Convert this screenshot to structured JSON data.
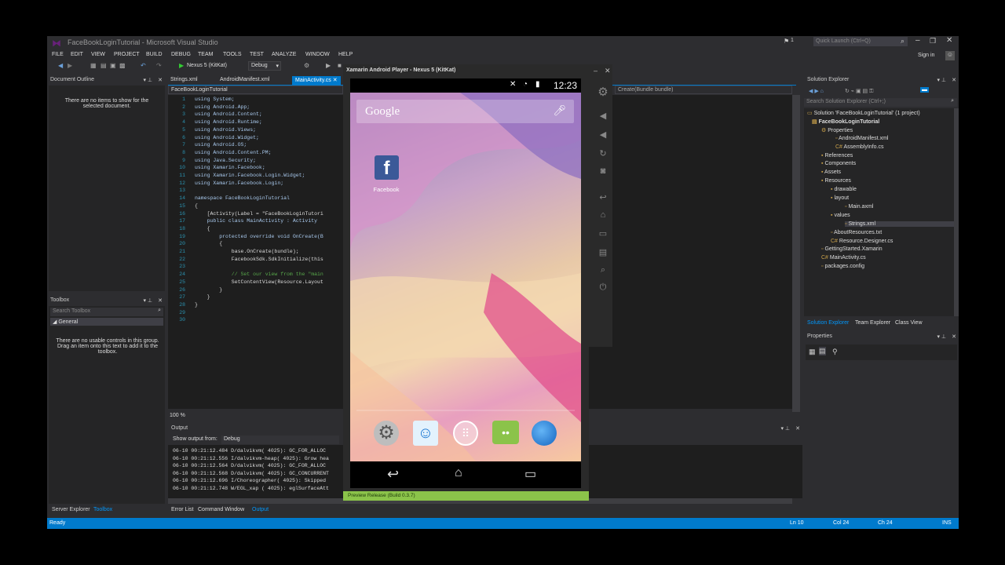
{
  "window": {
    "title": "FaceBookLoginTutorial - Microsoft Visual Studio",
    "quick_launch": "Quick Launch (Ctrl+Q)",
    "sign_in": "Sign in",
    "notif_count": "1"
  },
  "menu": [
    "FILE",
    "EDIT",
    "VIEW",
    "PROJECT",
    "BUILD",
    "DEBUG",
    "TEAM",
    "TOOLS",
    "TEST",
    "ANALYZE",
    "WINDOW",
    "HELP"
  ],
  "toolbar": {
    "device": "Nexus 5 (KitKat)",
    "config": "Debug"
  },
  "doc_outline": {
    "title": "Document Outline",
    "empty": "There are no items to show for the selected document."
  },
  "toolbox": {
    "title": "Toolbox",
    "search": "Search Toolbox",
    "group": "General",
    "empty": "There are no usable controls in this group. Drag an item onto this text to add it to the toolbox."
  },
  "bottom_tabs_left": [
    "Server Explorer",
    "Toolbox"
  ],
  "editor": {
    "tabs": [
      "Strings.xml",
      "AndroidManifest.xml",
      "MainActivity.cs"
    ],
    "nav": "FaceBookLoginTutorial",
    "nav_right": "Create(Bundle bundle)",
    "zoom": "100 %"
  },
  "code_lines": [
    "using System;",
    "using Android.App;",
    "using Android.Content;",
    "using Android.Runtime;",
    "using Android.Views;",
    "using Android.Widget;",
    "using Android.OS;",
    "using Android.Content.PM;",
    "using Java.Security;",
    "using Xamarin.Facebook;",
    "using Xamarin.Facebook.Login.Widget;",
    "using Xamarin.Facebook.Login;",
    "",
    "namespace FaceBookLoginTutorial",
    "{",
    "    [Activity(Label = \"FaceBookLoginTutori",
    "    public class MainActivity : Activity",
    "    {",
    "        protected override void OnCreate(B",
    "        {",
    "            base.OnCreate(bundle);",
    "            FacebookSdk.SdkInitialize(this",
    "",
    "            // Set our view from the \"main",
    "            SetContentView(Resource.Layout",
    "        }",
    "    }",
    "}",
    "",
    ""
  ],
  "output": {
    "title": "Output",
    "show_from": "Show output from:",
    "source": "Debug",
    "lines": [
      "06-10 00:21:12.484 D/dalvikvm( 4025): GC_FOR_ALLOC",
      "06-10 00:21:12.556 I/dalvikvm-heap( 4025): Grow hea",
      "06-10 00:21:12.564 D/dalvikvm( 4025): GC_FOR_ALLOC",
      "06-10 00:21:12.568 D/dalvikvm( 4025): GC_CONCURRENT",
      "06-10 00:21:12.696 I/Choreographer( 4025): Skipped",
      "06-10 00:21:12.748 W/EGL_xap ( 4025): eglSurfaceAtt"
    ],
    "bottom_tabs": [
      "Error List",
      "Command Window",
      "Output"
    ]
  },
  "emulator": {
    "title": "Xamarin Android Player - Nexus 5 (KitKat)",
    "time": "12:23",
    "google": "Google",
    "app_label": "Facebook",
    "footer": "Preview Release (Build 0.3.7)"
  },
  "solution": {
    "title": "Solution Explorer",
    "search": "Search Solution Explorer (Ctrl+;)",
    "items": [
      "Solution 'FaceBookLoginTutorial' (1 project)",
      "FaceBookLoginTutorial",
      "Properties",
      "AndroidManifest.xml",
      "AssemblyInfo.cs",
      "References",
      "Components",
      "Assets",
      "Resources",
      "drawable",
      "layout",
      "Main.axml",
      "values",
      "Strings.xml",
      "AboutResources.txt",
      "Resource.Designer.cs",
      "GettingStarted.Xamarin",
      "MainActivity.cs",
      "packages.config"
    ],
    "tabs": [
      "Solution Explorer",
      "Team Explorer",
      "Class View"
    ]
  },
  "properties": {
    "title": "Properties"
  },
  "status": {
    "ready": "Ready",
    "ln": "Ln 10",
    "col": "Col 24",
    "ch": "Ch 24",
    "ins": "INS"
  },
  "colors": {
    "accent": "#007acc",
    "bg": "#2d2d30",
    "panel": "#252526",
    "emu_green": "#8bc34a"
  }
}
